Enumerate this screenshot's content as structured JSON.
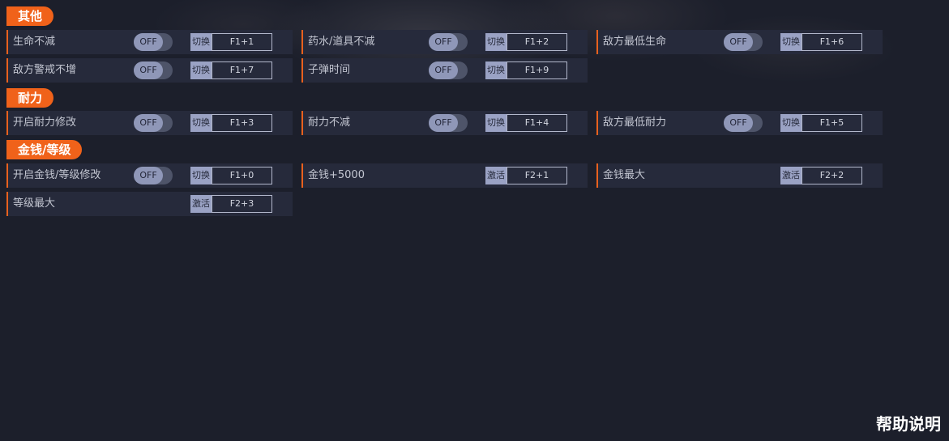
{
  "sections": {
    "other": {
      "title": "其他",
      "items": [
        {
          "label": "生命不减",
          "toggle": "OFF",
          "key_action": "切换",
          "hotkey": "F1+1"
        },
        {
          "label": "药水/道具不减",
          "toggle": "OFF",
          "key_action": "切换",
          "hotkey": "F1+2"
        },
        {
          "label": "敌方最低生命",
          "toggle": "OFF",
          "key_action": "切换",
          "hotkey": "F1+6"
        },
        {
          "label": "敌方警戒不增",
          "toggle": "OFF",
          "key_action": "切换",
          "hotkey": "F1+7"
        },
        {
          "label": "子弹时间",
          "toggle": "OFF",
          "key_action": "切换",
          "hotkey": "F1+9"
        }
      ]
    },
    "durability": {
      "title": "耐力",
      "items": [
        {
          "label": "开启耐力修改",
          "toggle": "OFF",
          "key_action": "切换",
          "hotkey": "F1+3"
        },
        {
          "label": "耐力不减",
          "toggle": "OFF",
          "key_action": "切换",
          "hotkey": "F1+4"
        },
        {
          "label": "敌方最低耐力",
          "toggle": "OFF",
          "key_action": "切换",
          "hotkey": "F1+5"
        }
      ]
    },
    "money": {
      "title": "金钱/等级",
      "items": [
        {
          "label": "开启金钱/等级修改",
          "toggle": "OFF",
          "key_action": "切换",
          "hotkey": "F1+0"
        },
        {
          "label": "金钱+5000",
          "key_action": "激活",
          "hotkey": "F2+1"
        },
        {
          "label": "金钱最大",
          "key_action": "激活",
          "hotkey": "F2+2"
        },
        {
          "label": "等级最大",
          "key_action": "激活",
          "hotkey": "F2+3"
        }
      ]
    }
  },
  "help_label": "帮助说明",
  "colors": {
    "accent": "#f0621a",
    "background": "#1c1f2b",
    "row": "#262a3b",
    "toggle_knob": "#8f97b8"
  }
}
